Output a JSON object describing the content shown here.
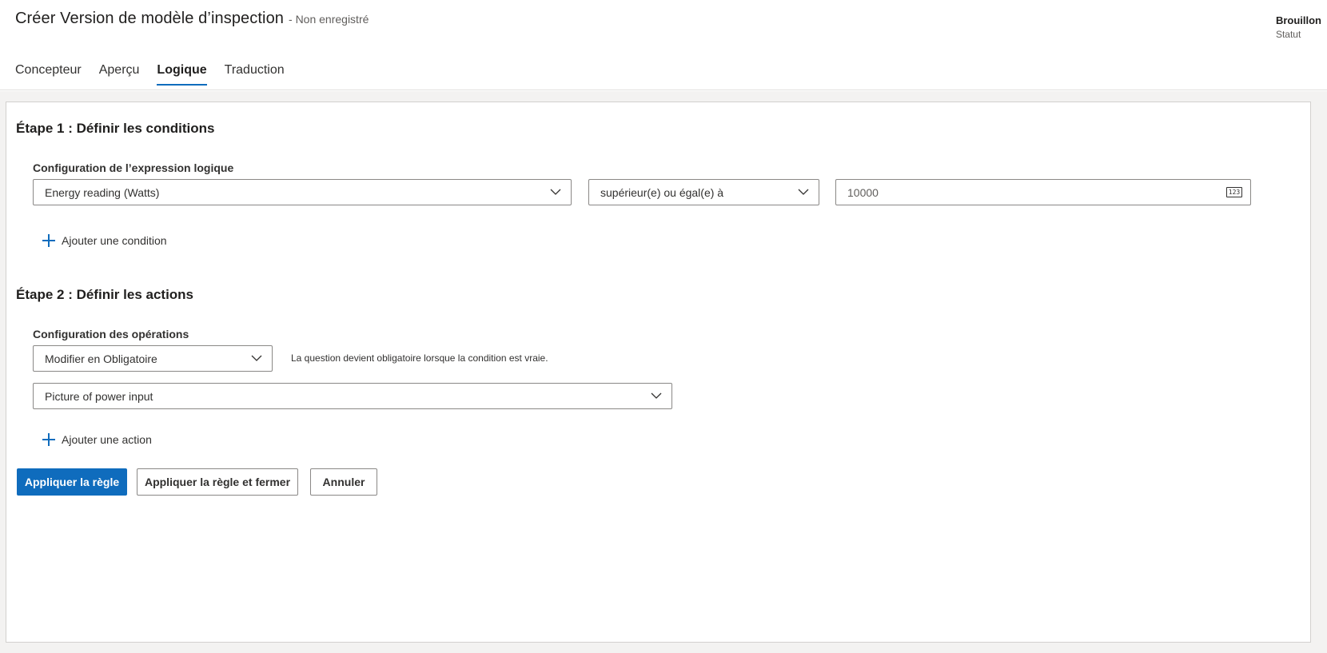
{
  "header": {
    "title": "Créer Version de modèle d’inspection",
    "save_state": "- Non enregistré",
    "status_value": "Brouillon",
    "status_label": "Statut"
  },
  "tabs": [
    {
      "label": "Concepteur",
      "active": false
    },
    {
      "label": "Aperçu",
      "active": false
    },
    {
      "label": "Logique",
      "active": true
    },
    {
      "label": "Traduction",
      "active": false
    }
  ],
  "step1": {
    "title": "Étape 1 : Définir les conditions",
    "expression_label": "Configuration de l’expression logique",
    "question_select": "Energy reading (Watts)",
    "operator_select": "supérieur(e) ou égal(e) à",
    "value_input": "10000",
    "value_badge": "123",
    "add_condition": "Ajouter une condition"
  },
  "step2": {
    "title": "Étape 2 : Définir les actions",
    "operations_label": "Configuration des opérations",
    "operation_select": "Modifier en Obligatoire",
    "operation_hint": "La question devient obligatoire lorsque la condition est vraie.",
    "target_select": "Picture of power input",
    "add_action": "Ajouter une action"
  },
  "buttons": {
    "apply": "Appliquer la règle",
    "apply_close": "Appliquer la règle et fermer",
    "cancel": "Annuler"
  },
  "colors": {
    "accent": "#0f6cbd",
    "border": "#8a8886",
    "text": "#323130"
  },
  "icons": {
    "dropdown": "chevron-down-icon",
    "add": "plus-icon",
    "number": "number-badge-icon"
  }
}
